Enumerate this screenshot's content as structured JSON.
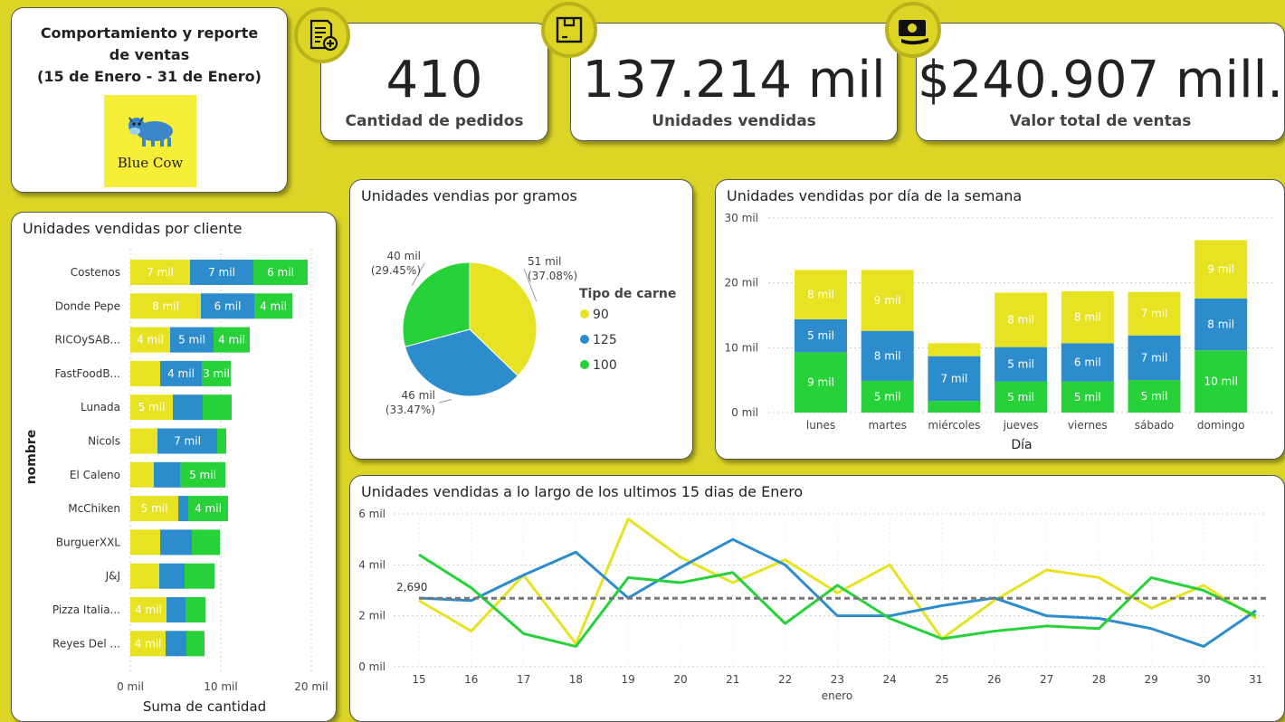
{
  "header": {
    "title_line1": "Comportamiento y reporte",
    "title_line2": "de ventas",
    "title_line3": "(15 de Enero - 31 de Enero)",
    "logo_text": "Blue Cow"
  },
  "kpis": [
    {
      "value": "410",
      "label": "Cantidad de pedidos",
      "icon": "document-add-icon"
    },
    {
      "value": "137.214 mil",
      "label": "Unidades vendidas",
      "icon": "box-icon"
    },
    {
      "value": "$240.907 mill.",
      "label": "Valor total de ventas",
      "icon": "money-icon"
    }
  ],
  "colors": {
    "c90": "#e8e322",
    "c125": "#2d8ccc",
    "c100": "#27d13a",
    "background": "#dcd526"
  },
  "chart_data": [
    {
      "id": "clientes",
      "type": "bar",
      "orientation": "horizontal",
      "stacked": true,
      "title": "Unidades vendidas por cliente",
      "ylabel": "nombre",
      "xlabel": "Suma de cantidad",
      "xlim": [
        0,
        20
      ],
      "xticks": [
        "0 mil",
        "10 mil",
        "20 mil"
      ],
      "categories": [
        "Costenos",
        "Donde Pepe",
        "RICOySAB...",
        "FastFoodB...",
        "Lunada",
        "Nicols",
        "El Caleno",
        "McChiken",
        "BurguerXXL",
        "J&J",
        "Pizza Italia...",
        "Reyes Del ..."
      ],
      "series": [
        {
          "key": "90",
          "values": [
            6.6,
            7.8,
            4.4,
            3.3,
            4.7,
            3.0,
            2.6,
            5.3,
            3.3,
            3.2,
            4.0,
            3.9
          ]
        },
        {
          "key": "125",
          "values": [
            7.0,
            5.9,
            4.8,
            4.6,
            3.3,
            6.6,
            2.9,
            1.1,
            3.5,
            2.8,
            2.1,
            2.3
          ]
        },
        {
          "key": "100",
          "values": [
            6.0,
            4.2,
            4.0,
            3.2,
            3.2,
            1.0,
            5.0,
            4.4,
            3.1,
            3.3,
            2.2,
            2.0
          ]
        }
      ],
      "labels": [
        [
          "7 mil",
          "7 mil",
          "6 mil"
        ],
        [
          "8 mil",
          "6 mil",
          "4 mil"
        ],
        [
          "4 mil",
          "5 mil",
          "4 mil"
        ],
        [
          "",
          "4 mil",
          "3 mil"
        ],
        [
          "5 mil",
          "",
          ""
        ],
        [
          "",
          "7 mil",
          ""
        ],
        [
          "",
          "",
          "5 mil"
        ],
        [
          "5 mil",
          "",
          "4 mil"
        ],
        [
          "",
          "",
          ""
        ],
        [
          "",
          "",
          ""
        ],
        [
          "4 mil",
          "",
          ""
        ],
        [
          "4 mil",
          "",
          ""
        ]
      ]
    },
    {
      "id": "gramos",
      "type": "pie",
      "title": "Unidades vendias por gramos",
      "legend_title": "Tipo de carne",
      "legend_position": "right",
      "slices": [
        {
          "label": "90",
          "value": 51,
          "value_label": "51 mil",
          "pct_label": "(37.08%)"
        },
        {
          "label": "125",
          "value": 46,
          "value_label": "46 mil",
          "pct_label": "(33.47%)"
        },
        {
          "label": "100",
          "value": 40,
          "value_label": "40 mil",
          "pct_label": "(29.45%)"
        }
      ]
    },
    {
      "id": "dias",
      "type": "bar",
      "stacked": true,
      "title": "Unidades vendidas por día de la semana",
      "xlabel": "Día",
      "ylim": [
        0,
        30
      ],
      "yticks": [
        "0 mil",
        "10 mil",
        "20 mil",
        "30 mil"
      ],
      "categories": [
        "lunes",
        "martes",
        "miércoles",
        "jueves",
        "viernes",
        "sábado",
        "domingo"
      ],
      "series": [
        {
          "key": "100",
          "values": [
            9.3,
            4.9,
            1.8,
            4.8,
            4.8,
            5.0,
            9.6
          ]
        },
        {
          "key": "125",
          "values": [
            5.1,
            7.7,
            6.9,
            5.3,
            5.9,
            6.9,
            8.0
          ]
        },
        {
          "key": "90",
          "values": [
            7.6,
            9.4,
            2.0,
            8.4,
            8.0,
            6.7,
            9.0
          ]
        }
      ],
      "labels": [
        [
          "9 mil",
          "5 mil",
          "8 mil"
        ],
        [
          "5 mil",
          "8 mil",
          "9 mil"
        ],
        [
          "",
          "7 mil",
          ""
        ],
        [
          "5 mil",
          "5 mil",
          "8 mil"
        ],
        [
          "5 mil",
          "6 mil",
          "8 mil"
        ],
        [
          "5 mil",
          "7 mil",
          "7 mil"
        ],
        [
          "10 mil",
          "8 mil",
          "9 mil"
        ]
      ]
    },
    {
      "id": "tendencia",
      "type": "line",
      "title": "Unidades vendidas a lo largo de los ultimos 15 dias de Enero",
      "xlabel": "enero",
      "ylim": [
        0,
        6
      ],
      "yticks": [
        "0 mil",
        "2 mil",
        "4 mil",
        "6 mil"
      ],
      "x": [
        "15",
        "16",
        "17",
        "18",
        "19",
        "20",
        "21",
        "22",
        "23",
        "24",
        "25",
        "26",
        "27",
        "28",
        "29",
        "30",
        "31"
      ],
      "series": [
        {
          "key": "90",
          "values": [
            2.6,
            1.4,
            3.6,
            0.9,
            5.8,
            4.3,
            3.3,
            4.2,
            2.9,
            4.0,
            1.1,
            2.6,
            3.8,
            3.5,
            2.3,
            3.2,
            1.9
          ]
        },
        {
          "key": "125",
          "values": [
            2.7,
            2.6,
            3.6,
            4.5,
            2.7,
            3.9,
            5.0,
            4.0,
            2.0,
            2.0,
            2.4,
            2.7,
            2.0,
            1.9,
            1.5,
            0.8,
            2.2
          ]
        },
        {
          "key": "100",
          "values": [
            4.4,
            3.1,
            1.3,
            0.8,
            3.5,
            3.3,
            3.7,
            1.7,
            3.2,
            1.9,
            1.1,
            1.4,
            1.6,
            1.5,
            3.5,
            3.0,
            2.0
          ]
        }
      ],
      "reference": {
        "value": 2.69,
        "label": "2,690"
      }
    }
  ]
}
